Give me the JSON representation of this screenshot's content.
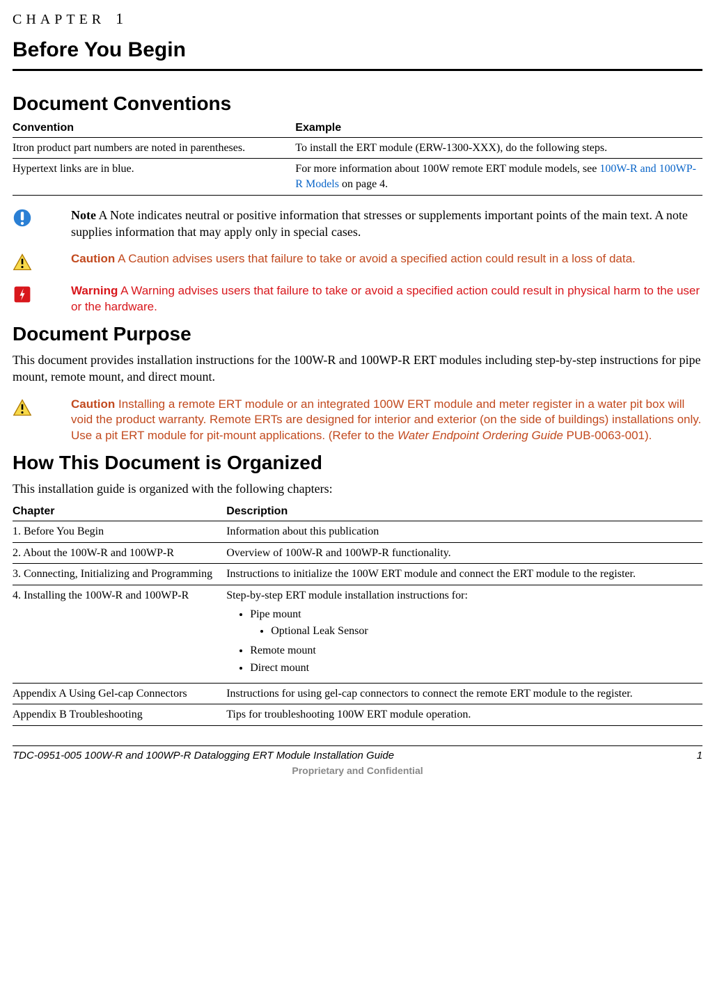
{
  "chapter_label": "CHAPTER",
  "chapter_number": "1",
  "page_title": "Before You Begin",
  "sections": {
    "conventions": {
      "heading": "Document Conventions",
      "th_convention": "Convention",
      "th_example": "Example",
      "rows": [
        {
          "convention": "Itron product part numbers are noted in parentheses.",
          "example_pre": "To install the ERT module (ERW-1300-XXX), do the following steps.",
          "example_link": "",
          "example_post": ""
        },
        {
          "convention": "Hypertext links are in blue.",
          "example_pre": "For more information about 100W remote ERT module models, see ",
          "example_link": "100W-R and 100WP-R Models",
          "example_post": " on page 4."
        }
      ]
    },
    "callouts": {
      "note": {
        "tag": "Note",
        "text": "  A Note indicates neutral or positive information that stresses or supplements important points of the main text. A note supplies information that may apply only in special cases."
      },
      "caution1": {
        "tag": "Caution",
        "text": "  A Caution advises users that failure to take or avoid a specified action could result in a loss of data."
      },
      "warning": {
        "tag": "Warning",
        "text": "  A Warning advises users that failure to take or avoid a specified action could result in physical harm to the user or the hardware."
      },
      "caution2": {
        "tag": "Caution",
        "text_a": "  Installing a remote ERT module or an integrated 100W ERT module and meter register in a water pit box will void the product warranty. Remote ERTs are designed for interior and exterior (on the side of buildings) installations only. Use a pit ERT module for pit-mount applications. (Refer to the ",
        "text_italic": "Water Endpoint Ordering Guide",
        "text_b": " PUB-0063-001)."
      }
    },
    "purpose": {
      "heading": "Document Purpose",
      "body": "This document provides installation instructions for the 100W-R and 100WP-R ERT modules including step-by-step instructions for pipe mount, remote mount, and direct mount."
    },
    "organized": {
      "heading": "How This Document is Organized",
      "intro": "This installation guide is organized with the following chapters:",
      "th_chapter": "Chapter",
      "th_desc": "Description",
      "rows": [
        {
          "chapter": "1. Before You Begin",
          "desc": "Information about this publication"
        },
        {
          "chapter": "2. About the 100W-R and 100WP-R",
          "desc": "Overview of 100W-R and 100WP-R functionality."
        },
        {
          "chapter": "3. Connecting, Initializing and Programming",
          "desc": "Instructions to initialize the 100W ERT module and connect the ERT module to the register."
        },
        {
          "chapter": "4. Installing the 100W-R and 100WP-R",
          "desc_intro": "Step-by-step ERT module installation instructions for:",
          "bullets": [
            "Pipe mount",
            "Remote mount",
            "Direct mount"
          ],
          "sub_bullets": [
            "Optional Leak Sensor"
          ]
        },
        {
          "chapter": "Appendix A Using Gel-cap Connectors",
          "desc": "Instructions for using gel-cap connectors to connect the remote ERT module to the register."
        },
        {
          "chapter": "Appendix B Troubleshooting",
          "desc": "Tips for troubleshooting 100W ERT module operation."
        }
      ]
    }
  },
  "footer": {
    "left": "TDC-0951-005 100W-R and 100WP-R Datalogging ERT Module Installation Guide",
    "right": "1",
    "sub": "Proprietary and Confidential"
  }
}
